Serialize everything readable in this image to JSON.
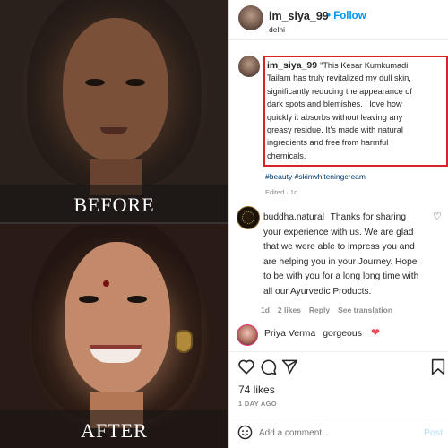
{
  "before_after": {
    "before_label": "BEFORE",
    "after_label": "AFTER"
  },
  "post": {
    "author": "im_siya_99",
    "follow_label": "Follow",
    "location": "delhi",
    "comment_lines": [
      "\"This Kesar Kumkumadi",
      "Tailam has truly revitalized my dull skin,",
      "significantly reducing the appearance of",
      "dark spots and blemishes. I love how",
      "quickly it absorbs without leaving any",
      "greasy residue. It's made with natural",
      "ingredients and free from harmful",
      "chemicals."
    ],
    "hashtags": "#beauty #skinwhiteningcream",
    "edited_meta": "Edited · 1d"
  },
  "reply": {
    "author": "buddha.natural",
    "lines": [
      "Thanks for sharing",
      "your experience with us. We are glad",
      "that we were able to impress you and",
      "are helping you in your Journey. Hope",
      "to be with you for a long long time with",
      "all our Ayurvedic Products."
    ],
    "age": "1d",
    "likes": "2 likes",
    "reply_label": "Reply",
    "translate_label": "See translation"
  },
  "comment2": {
    "author": "Priya Verma",
    "text": "gorgeous"
  },
  "footer": {
    "likes_count": "74 likes",
    "time_ago": "1 DAY AGO",
    "add_comment_placeholder": "Add a comment...",
    "post_label": "Post"
  },
  "icons": {
    "like": "heart-icon",
    "comment": "comment-icon",
    "share": "share-icon",
    "save": "bookmark-icon",
    "emoji": "emoji-icon",
    "reaction": "red-heart-icon"
  },
  "colors": {
    "link_blue": "#0095f6",
    "highlight_red": "#d6232a",
    "hashtag": "#00376b",
    "muted": "#8e8e8e",
    "heart_red": "#ed4956"
  }
}
